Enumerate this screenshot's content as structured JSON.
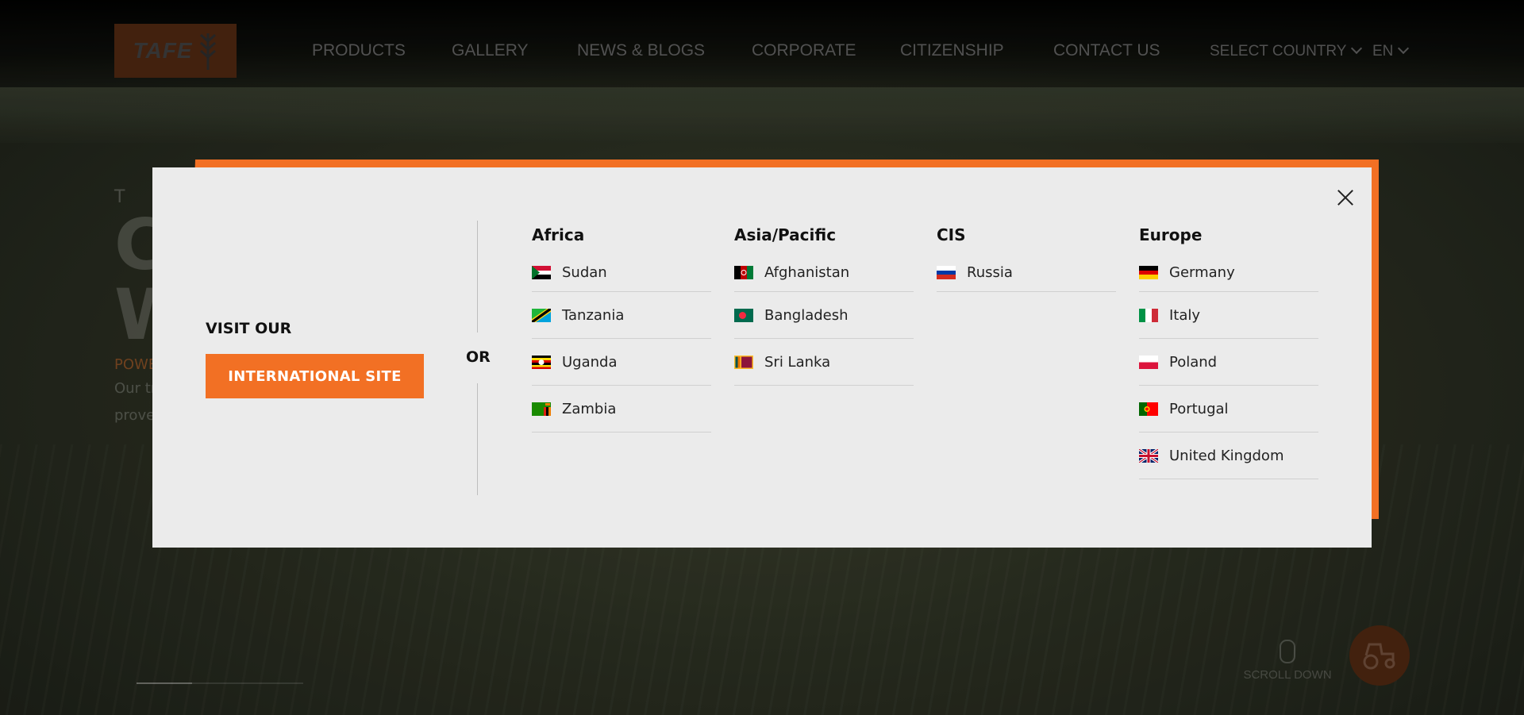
{
  "header": {
    "logo_text": "TAFE",
    "nav": [
      "PRODUCTS",
      "GALLERY",
      "NEWS & BLOGS",
      "CORPORATE",
      "CITIZENSHIP",
      "CONTACT US"
    ],
    "select_country": "SELECT COUNTRY",
    "language": "EN"
  },
  "hero": {
    "tag": "T A",
    "big_line1": "C",
    "big_line2": "W",
    "sub": "POWE",
    "desc_line1": "Our tr",
    "desc_line2": "prove"
  },
  "scroll_down": "SCROLL DOWN",
  "modal": {
    "visit_label": "VISIT OUR",
    "international_button": "INTERNATIONAL SITE",
    "or_label": "OR",
    "regions": [
      {
        "title": "Africa",
        "countries": [
          {
            "name": "Sudan",
            "flag": "sudan"
          },
          {
            "name": "Tanzania",
            "flag": "tanzania"
          },
          {
            "name": "Uganda",
            "flag": "uganda"
          },
          {
            "name": "Zambia",
            "flag": "zambia"
          }
        ]
      },
      {
        "title": "Asia/Pacific",
        "countries": [
          {
            "name": "Afghanistan",
            "flag": "afghanistan"
          },
          {
            "name": "Bangladesh",
            "flag": "bangladesh"
          },
          {
            "name": "Sri Lanka",
            "flag": "sri-lanka"
          }
        ]
      },
      {
        "title": "CIS",
        "countries": [
          {
            "name": "Russia",
            "flag": "russia"
          }
        ]
      },
      {
        "title": "Europe",
        "countries": [
          {
            "name": "Germany",
            "flag": "germany"
          },
          {
            "name": "Italy",
            "flag": "italy"
          },
          {
            "name": "Poland",
            "flag": "poland"
          },
          {
            "name": "Portugal",
            "flag": "portugal"
          },
          {
            "name": "United Kingdom",
            "flag": "united-kingdom"
          }
        ]
      }
    ]
  },
  "colors": {
    "accent": "#f27024",
    "modal_bg": "#ebebeb"
  }
}
